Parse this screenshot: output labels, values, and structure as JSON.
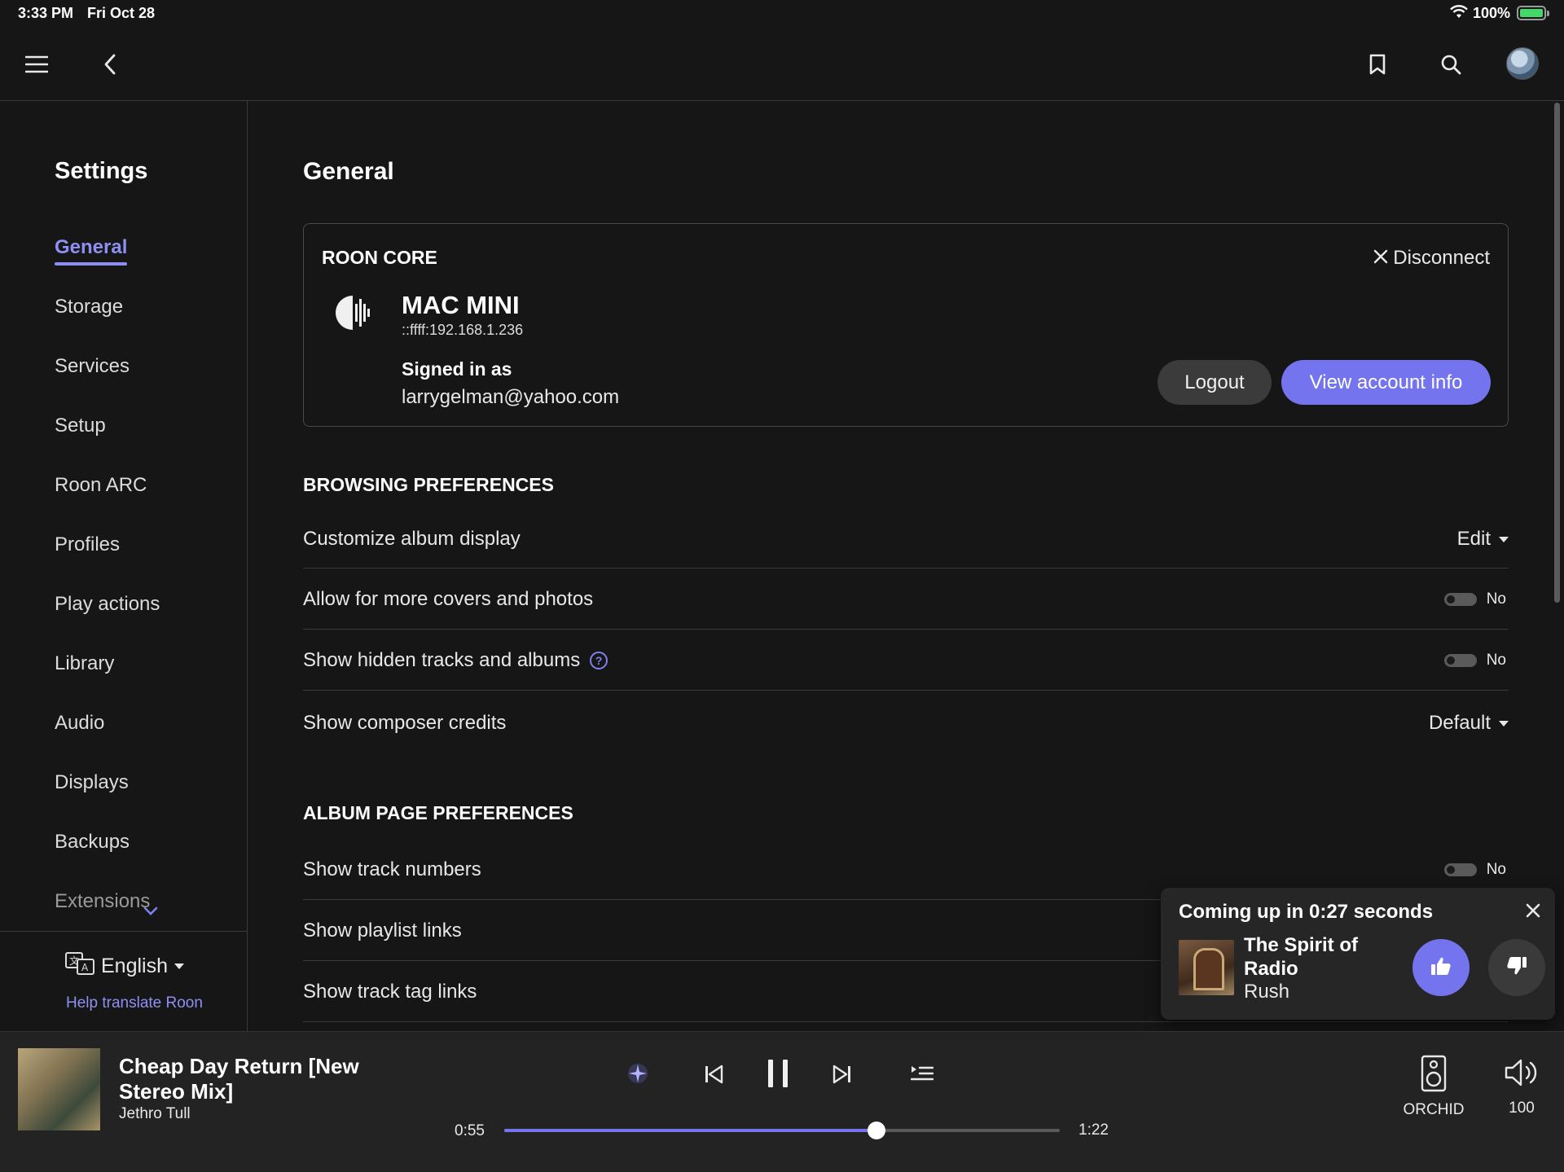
{
  "status_bar": {
    "time": "3:33 PM",
    "date": "Fri Oct 28",
    "battery": "100%"
  },
  "sidebar": {
    "title": "Settings",
    "items": [
      {
        "label": "General",
        "active": true
      },
      {
        "label": "Storage"
      },
      {
        "label": "Services"
      },
      {
        "label": "Setup"
      },
      {
        "label": "Roon ARC"
      },
      {
        "label": "Profiles"
      },
      {
        "label": "Play actions"
      },
      {
        "label": "Library"
      },
      {
        "label": "Audio"
      },
      {
        "label": "Displays"
      },
      {
        "label": "Backups"
      },
      {
        "label": "Extensions"
      }
    ],
    "language": "English",
    "help_translate": "Help translate Roon"
  },
  "main": {
    "title": "General",
    "core": {
      "section_label": "ROON CORE",
      "disconnect_label": "Disconnect",
      "name": "MAC MINI",
      "ip": "::ffff:192.168.1.236",
      "signed_in_label": "Signed in as",
      "email": "larrygelman@yahoo.com",
      "logout_label": "Logout",
      "account_label": "View account info"
    },
    "browsing": {
      "heading": "BROWSING PREFERENCES",
      "rows": [
        {
          "label": "Customize album display",
          "value": "Edit"
        },
        {
          "label": "Allow for more covers and photos",
          "value": "No"
        },
        {
          "label": "Show hidden tracks and albums",
          "value": "No"
        },
        {
          "label": "Show composer credits",
          "value": "Default"
        }
      ]
    },
    "album_page": {
      "heading": "ALBUM PAGE PREFERENCES",
      "rows": [
        {
          "label": "Show track numbers",
          "value": "No"
        },
        {
          "label": "Show playlist links"
        },
        {
          "label": "Show track tag links"
        }
      ]
    }
  },
  "up_next": {
    "title": "Coming up in 0:27 seconds",
    "track": "The Spirit of Radio",
    "artist": "Rush"
  },
  "player": {
    "track": "Cheap Day Return [New Stereo Mix]",
    "artist": "Jethro Tull",
    "elapsed": "0:55",
    "total": "1:22",
    "progress_fraction": 0.67,
    "zone": "ORCHID",
    "volume": "100"
  },
  "colors": {
    "accent": "#7474ee",
    "background": "#161616",
    "panel": "#232323"
  }
}
